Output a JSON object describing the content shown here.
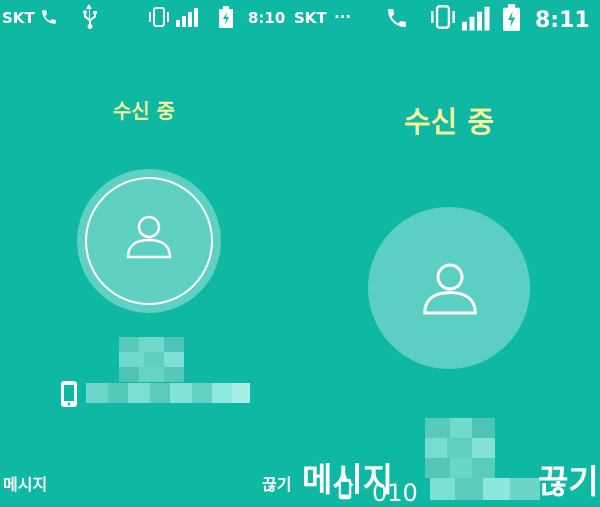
{
  "status_left": {
    "carrier": "SKT",
    "time": "8:10"
  },
  "status_right": {
    "carrier": "SKT",
    "dots": "···",
    "time": "8:11"
  },
  "screen_left": {
    "title": "수신 중",
    "message_label": "메시지",
    "end_label": "끊기"
  },
  "screen_right": {
    "title": "수신 중",
    "message_label": "메시지",
    "end_label": "끊기",
    "number_partial": "010"
  },
  "colors": {
    "background": "#0fb8a3",
    "title": "#f6f39c",
    "avatar_fill": "#5bd0c2"
  }
}
